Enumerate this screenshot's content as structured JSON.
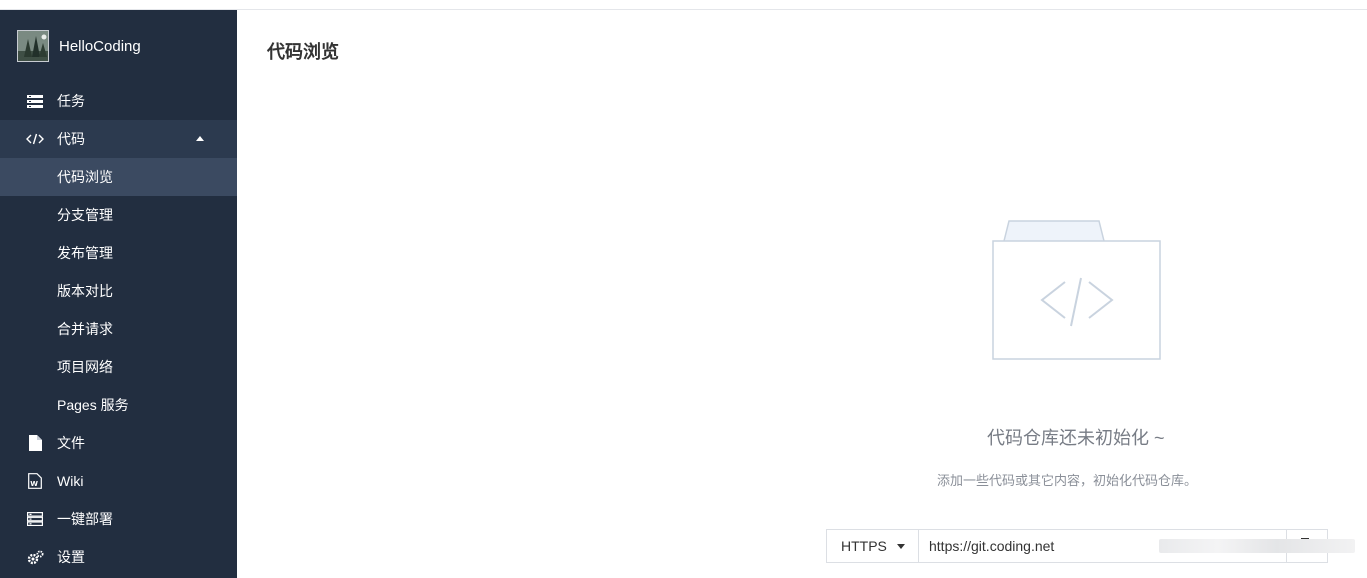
{
  "brand": {
    "name": "HelloCoding",
    "avatar_icon": "forest-avatar"
  },
  "sidebar": {
    "items": [
      {
        "label": "任务",
        "icon": "tasks-icon"
      },
      {
        "label": "代码",
        "icon": "code-icon",
        "expanded": true
      },
      {
        "label": "代码浏览",
        "sub": true,
        "active": true
      },
      {
        "label": "分支管理",
        "sub": true
      },
      {
        "label": "发布管理",
        "sub": true
      },
      {
        "label": "版本对比",
        "sub": true
      },
      {
        "label": "合并请求",
        "sub": true
      },
      {
        "label": "项目网络",
        "sub": true
      },
      {
        "label": "Pages 服务",
        "sub": true
      },
      {
        "label": "文件",
        "icon": "file-icon"
      },
      {
        "label": "Wiki",
        "icon": "wiki-icon"
      },
      {
        "label": "一键部署",
        "icon": "deploy-icon"
      },
      {
        "label": "设置",
        "icon": "settings-icon"
      }
    ]
  },
  "main": {
    "title": "代码浏览",
    "empty": {
      "title": "代码仓库还未初始化 ~",
      "desc": "添加一些代码或其它内容，初始化代码仓库。"
    },
    "clone": {
      "protocol": "HTTPS",
      "url": "https://git.coding.net"
    }
  },
  "colors": {
    "sidebar_bg": "#222e40",
    "active_bg": "#3b4a61",
    "accent_muted": "#c9d3df"
  }
}
